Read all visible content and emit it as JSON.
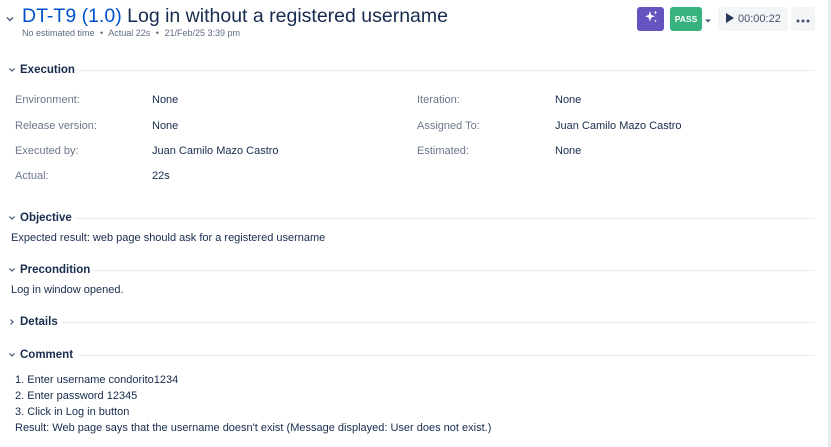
{
  "header": {
    "key": "DT-T9",
    "version": "(1.0)",
    "title": "Log in without a registered username",
    "meta": {
      "estimated": "No estimated time",
      "actual": "Actual 22s",
      "date": "21/Feb/25 3:39 pm"
    },
    "pass_label": "PASS",
    "timer": "00:00:22",
    "icons": {
      "collapse": "chevron-down-icon",
      "ai": "sparkle-icon",
      "play": "play-icon",
      "more": "more-icon"
    },
    "colors": {
      "ai": "#6554c0",
      "pass": "#36b37e",
      "key": "#0052cc"
    }
  },
  "execution": {
    "title": "Execution",
    "fields_left": [
      {
        "label": "Environment:",
        "value": "None"
      },
      {
        "label": "Release version:",
        "value": "None"
      },
      {
        "label": "Executed by:",
        "value": "Juan Camilo Mazo Castro"
      },
      {
        "label": "Actual:",
        "value": "22s"
      }
    ],
    "fields_right": [
      {
        "label": "Iteration:",
        "value": "None"
      },
      {
        "label": "Assigned To:",
        "value": "Juan Camilo Mazo Castro"
      },
      {
        "label": "Estimated:",
        "value": "None"
      }
    ]
  },
  "objective": {
    "title": "Objective",
    "text": "Expected result: web page should ask for a registered username"
  },
  "precondition": {
    "title": "Precondition",
    "text": "Log in window opened."
  },
  "details": {
    "title": "Details"
  },
  "comment": {
    "title": "Comment",
    "lines": [
      "1. Enter username condorito1234",
      "2. Enter password 12345",
      "3. Click in Log in button",
      "Result: Web page says that the username doesn't exist  (Message displayed: User does not exist.)"
    ]
  }
}
